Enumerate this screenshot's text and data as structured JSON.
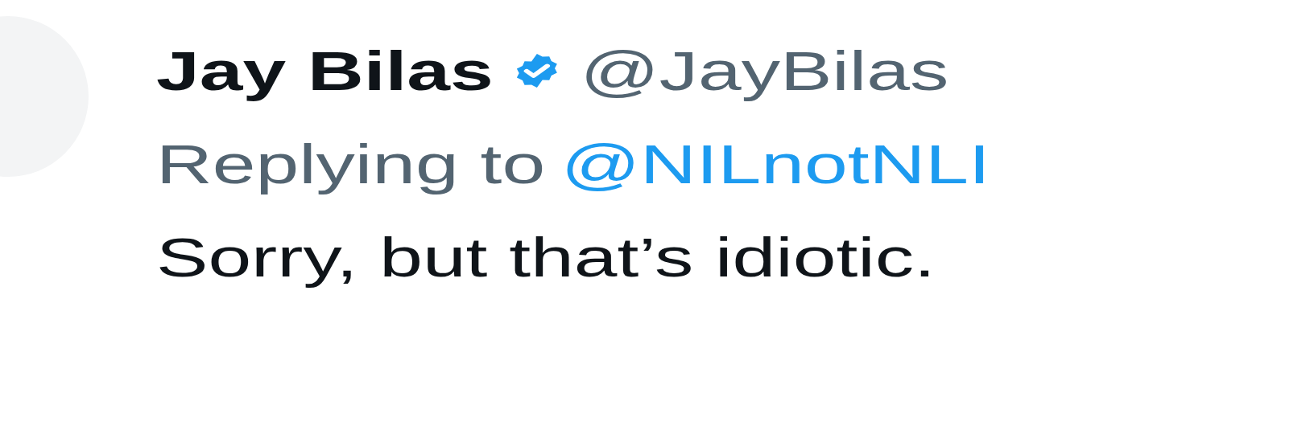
{
  "tweet": {
    "name": "Jay Bilas",
    "verified": true,
    "handle": "@JayBilas",
    "replying_label": "Replying to",
    "reply_to": "@NILnotNLI",
    "text": "Sorry, but that’s idiotic."
  }
}
